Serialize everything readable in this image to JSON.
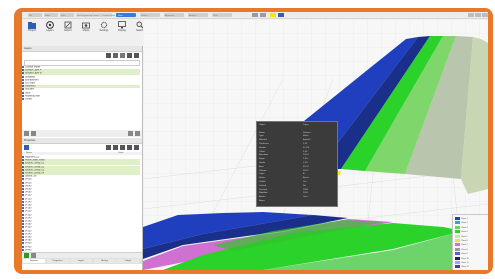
{
  "window": {
    "title_text": "Geo-Engineering Viewer — Corridor Model",
    "tabs": [
      "File",
      "Home",
      "Data",
      "View",
      "Surface",
      "Alignment",
      "Analysis",
      "Tools"
    ],
    "active_tab": "View"
  },
  "ribbon": {
    "buttons": [
      {
        "label": "Project",
        "icon": "folder-icon"
      },
      {
        "label": "Layers",
        "icon": "layers-icon"
      },
      {
        "label": "Export",
        "icon": "export-icon"
      },
      {
        "label": "Views",
        "icon": "camera-icon"
      },
      {
        "label": "Settings",
        "icon": "gear-icon"
      },
      {
        "label": "Display",
        "icon": "monitor-icon"
      },
      {
        "label": "Search",
        "icon": "search-icon"
      }
    ]
  },
  "layers_panel": {
    "title": "Layers",
    "search_placeholder": "Search",
    "items": [
      {
        "label": "Corridor Model",
        "count": "",
        "highlight": false
      },
      {
        "label": "Surface Layer A",
        "count": "",
        "highlight": true
      },
      {
        "label": "Surface Layer B",
        "count": "",
        "highlight": true
      },
      {
        "label": "Subgrade",
        "count": "",
        "highlight": false
      },
      {
        "label": "Embankment",
        "count": "",
        "highlight": false
      },
      {
        "label": "Cut Slope",
        "count": "",
        "highlight": false
      },
      {
        "label": "Pavement",
        "count": "",
        "highlight": true
      },
      {
        "label": "Shoulder",
        "count": "",
        "highlight": false
      },
      {
        "label": "Ditch",
        "count": "",
        "highlight": false
      },
      {
        "label": "Retaining Wall",
        "count": "",
        "highlight": false
      },
      {
        "label": "Terrain",
        "count": "",
        "highlight": false
      }
    ]
  },
  "objects_panel": {
    "title": "Properties",
    "col_name": "Name",
    "col_value": "Value",
    "items": [
      {
        "label": "Alignment_01",
        "count": "",
        "highlight": false
      },
      {
        "label": "Profile_Main_Road",
        "count": "",
        "highlight": true
      },
      {
        "label": "Section_Group_01",
        "count": "",
        "highlight": true
      },
      {
        "label": "Section_Group_02",
        "count": "",
        "highlight": true
      },
      {
        "label": "Section_Group_03",
        "count": "",
        "highlight": true
      },
      {
        "label": "Section_Group_04",
        "count": "",
        "highlight": true
      },
      {
        "label": "Station List",
        "count": "",
        "highlight": false
      },
      {
        "label": "0+000",
        "count": "",
        "highlight": false
      },
      {
        "label": "0+020",
        "count": "",
        "highlight": false
      },
      {
        "label": "0+040",
        "count": "",
        "highlight": false
      },
      {
        "label": "0+060",
        "count": "",
        "highlight": false
      },
      {
        "label": "0+080",
        "count": "",
        "highlight": false
      },
      {
        "label": "0+100",
        "count": "",
        "highlight": false
      },
      {
        "label": "0+120",
        "count": "",
        "highlight": false
      },
      {
        "label": "0+140",
        "count": "",
        "highlight": false
      },
      {
        "label": "0+160",
        "count": "",
        "highlight": false
      },
      {
        "label": "0+180",
        "count": "",
        "highlight": false
      },
      {
        "label": "0+200",
        "count": "",
        "highlight": false
      },
      {
        "label": "0+220",
        "count": "",
        "highlight": false
      },
      {
        "label": "0+240",
        "count": "",
        "highlight": false
      },
      {
        "label": "0+260",
        "count": "",
        "highlight": false
      },
      {
        "label": "0+280",
        "count": "",
        "highlight": false
      },
      {
        "label": "0+300",
        "count": "",
        "highlight": false
      },
      {
        "label": "0+320",
        "count": "",
        "highlight": false
      },
      {
        "label": "0+340",
        "count": "",
        "highlight": false
      },
      {
        "label": "0+360",
        "count": "",
        "highlight": false
      },
      {
        "label": "0+380",
        "count": "",
        "highlight": false
      },
      {
        "label": "0+400",
        "count": "",
        "highlight": false
      },
      {
        "label": "0+420",
        "count": "",
        "highlight": false
      },
      {
        "label": "0+440",
        "count": "",
        "highlight": false
      }
    ]
  },
  "status_bar": {
    "tabs": [
      "Explorer",
      "Properties",
      "Layers",
      "History",
      "Output"
    ]
  },
  "popup": {
    "rows": [
      {
        "key": "Object",
        "value": "Layer"
      },
      {
        "key": "",
        "value": ""
      },
      {
        "key": "Name",
        "value": "Surface"
      },
      {
        "key": "Type",
        "value": "Mesh"
      },
      {
        "key": "Material",
        "value": "Asphalt"
      },
      {
        "key": "Thickness",
        "value": "0.25"
      },
      {
        "key": "Station",
        "value": "0+120"
      },
      {
        "key": "Offset",
        "value": "3.50"
      },
      {
        "key": "Elevation",
        "value": "125.4"
      },
      {
        "key": "Slope",
        "value": "2.0%"
      },
      {
        "key": "Grade",
        "value": "1.5%"
      },
      {
        "key": "Area",
        "value": "412.8"
      },
      {
        "key": "Volume",
        "value": "103.2"
      },
      {
        "key": "Layer",
        "value": "A"
      },
      {
        "key": "Status",
        "value": "Active"
      },
      {
        "key": "Visible",
        "value": "Yes"
      },
      {
        "key": "Locked",
        "value": "No"
      },
      {
        "key": "Created",
        "value": "2023"
      },
      {
        "key": "Modified",
        "value": "2024"
      },
      {
        "key": "Author",
        "value": "User"
      },
      {
        "key": "Notes",
        "value": ""
      }
    ]
  },
  "legend": {
    "items": [
      {
        "label": "Class 1",
        "color": "#1f3fbf"
      },
      {
        "label": "Class 2",
        "color": "#3aa0e0"
      },
      {
        "label": "Class 3",
        "color": "#6fd060"
      },
      {
        "label": "Class 4",
        "color": "#2ad22a"
      },
      {
        "label": "Class 5",
        "color": "#c8e6a0"
      },
      {
        "label": "Class 6",
        "color": "#e8e05a"
      },
      {
        "label": "Class 7",
        "color": "#d070d0"
      },
      {
        "label": "Class 8",
        "color": "#9b9b9b"
      },
      {
        "label": "Class 9",
        "color": "#5a5ae0"
      },
      {
        "label": "Class 10",
        "color": "#202060"
      },
      {
        "label": "Class 11",
        "color": "#a0a0ff"
      },
      {
        "label": "Class 12",
        "color": "#4040a0"
      }
    ]
  },
  "colors": {
    "accent_frame": "#e8792a",
    "active_tab": "#3a7bd5",
    "navy": "#1f3fbf",
    "green": "#2ad22a",
    "light_green": "#c8e6a0",
    "yellow": "#f2f20a",
    "magenta": "#d070d0",
    "grey_wall": "#b9c6ad"
  }
}
